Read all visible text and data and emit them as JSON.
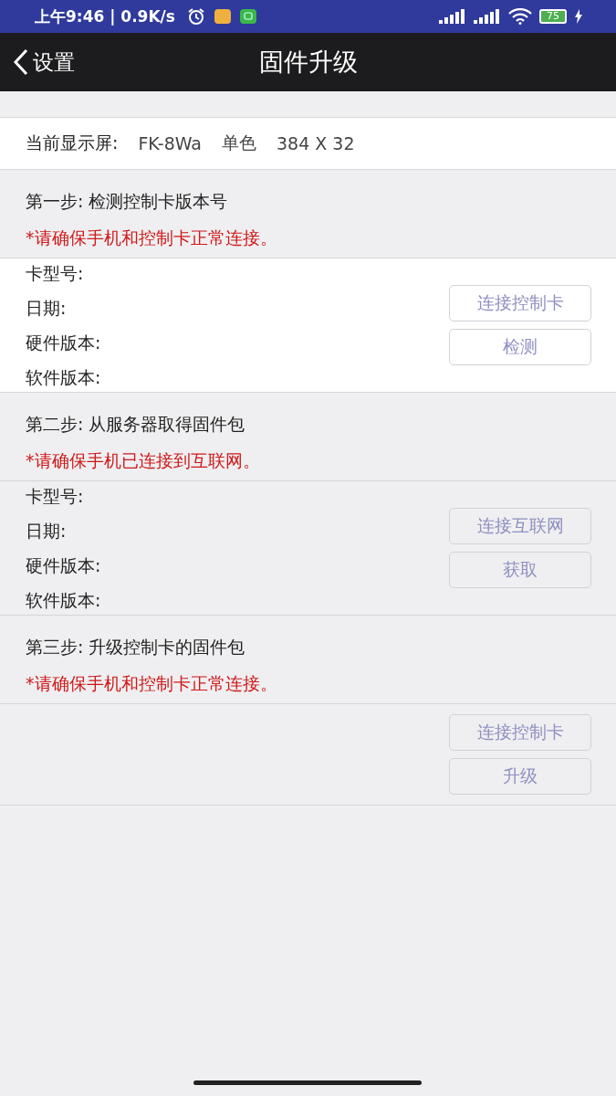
{
  "status_bar": {
    "time": "上午9:46 | 0.9K/s",
    "battery": "75"
  },
  "nav": {
    "back": "设置",
    "title": "固件升级"
  },
  "display": {
    "label": "当前显示屏:",
    "model": "FK-8Wa",
    "color_mode": "单色",
    "resolution": "384 X 32"
  },
  "steps": [
    {
      "title": "第一步: 检测控制卡版本号",
      "warning": "*请确保手机和控制卡正常连接。",
      "active": true,
      "fields": [
        "卡型号:",
        "日期:",
        "硬件版本:",
        "软件版本:"
      ],
      "buttons": [
        "连接控制卡",
        "检测"
      ]
    },
    {
      "title": "第二步: 从服务器取得固件包",
      "warning": "*请确保手机已连接到互联网。",
      "active": false,
      "fields": [
        "卡型号:",
        "日期:",
        "硬件版本:",
        "软件版本:"
      ],
      "buttons": [
        "连接互联网",
        "获取"
      ]
    },
    {
      "title": "第三步: 升级控制卡的固件包",
      "warning": "*请确保手机和控制卡正常连接。",
      "active": false,
      "buttons": [
        "连接控制卡",
        "升级"
      ]
    }
  ]
}
